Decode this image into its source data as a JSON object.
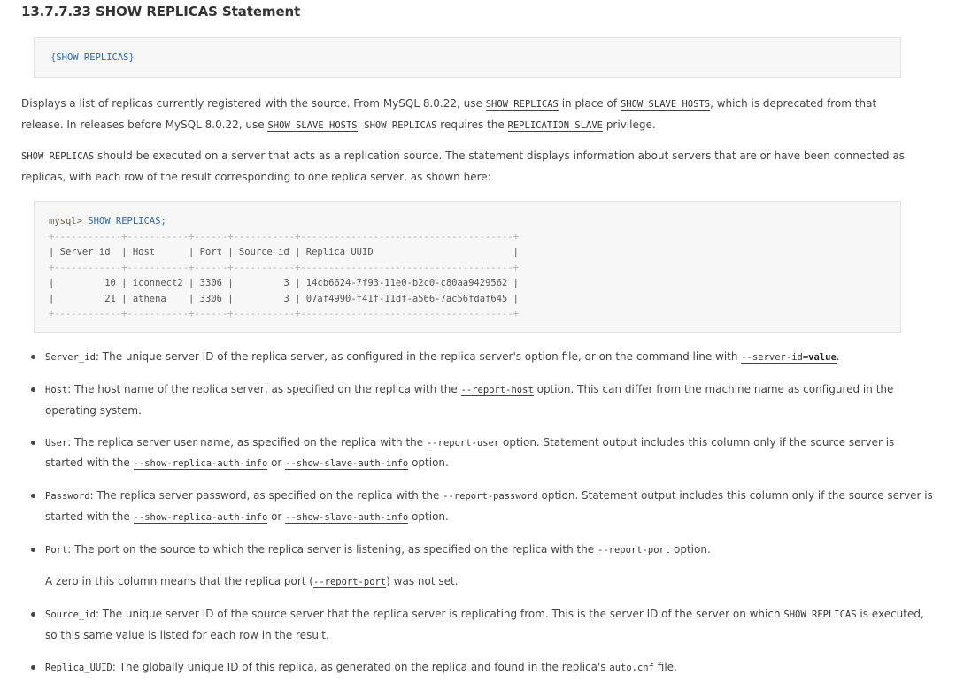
{
  "title": "13.7.7.33 SHOW REPLICAS Statement",
  "syntax": "{SHOW REPLICAS}",
  "para1": {
    "t1": "Displays a list of replicas currently registered with the source. From MySQL 8.0.22, use ",
    "c1": "SHOW REPLICAS",
    "t2": " in place of ",
    "c2": "SHOW SLAVE HOSTS",
    "t3": ", which is deprecated from that release. In releases before MySQL 8.0.22, use ",
    "c3": "SHOW SLAVE HOSTS",
    "t4": ". ",
    "c4": "SHOW REPLICAS",
    "t5": " requires the ",
    "c5": "REPLICATION SLAVE",
    "t6": " privilege."
  },
  "para2": {
    "c1": "SHOW REPLICAS",
    "t1": " should be executed on a server that acts as a replication source. The statement displays information about servers that are or have been connected as replicas, with each row of the result corresponding to one replica server, as shown here:"
  },
  "sample": {
    "prompt": "mysql>",
    "command": " SHOW REPLICAS;",
    "border": "+------------+-----------+------+-----------+--------------------------------------+",
    "header": "| Server_id  | Host      | Port | Source_id | Replica_UUID                         |",
    "row1": "|         10 | iconnect2 | 3306 |         3 | 14cb6624-7f93-11e0-b2c0-c80aa9429562 |",
    "row2": "|         21 | athena    | 3306 |         3 | 07af4990-f41f-11df-a566-7ac56fdaf645 |"
  },
  "items": {
    "server_id": {
      "term": "Server_id",
      "t1": ": The unique server ID of the replica server, as configured in the replica server's option file, or on the command line with ",
      "opt": "--server-id=",
      "val": "value",
      "t2": "."
    },
    "host": {
      "term": "Host",
      "t1": ": The host name of the replica server, as specified on the replica with the ",
      "opt": "--report-host",
      "t2": " option. This can differ from the machine name as configured in the operating system."
    },
    "user": {
      "term": "User",
      "t1": ": The replica server user name, as specified on the replica with the ",
      "opt1": "--report-user",
      "t2": " option. Statement output includes this column only if the source server is started with the ",
      "opt2": "--show-replica-auth-info",
      "t3": " or ",
      "opt3": "--show-slave-auth-info",
      "t4": " option."
    },
    "password": {
      "term": "Password",
      "t1": ": The replica server password, as specified on the replica with the ",
      "opt1": "--report-password",
      "t2": " option. Statement output includes this column only if the source server is started with the ",
      "opt2": "--show-replica-auth-info",
      "t3": " or ",
      "opt3": "--show-slave-auth-info",
      "t4": " option."
    },
    "port": {
      "term": "Port",
      "t1": ": The port on the source to which the replica server is listening, as specified on the replica with the ",
      "opt": "--report-port",
      "t2": " option.",
      "sub_t1": "A zero in this column means that the replica port (",
      "sub_opt": "--report-port",
      "sub_t2": ") was not set."
    },
    "source_id": {
      "term": "Source_id",
      "t1": ": The unique server ID of the source server that the replica server is replicating from. This is the server ID of the server on which ",
      "code": "SHOW REPLICAS",
      "t2": " is executed, so this same value is listed for each row in the result."
    },
    "replica_uuid": {
      "term": "Replica_UUID",
      "t1": ": The globally unique ID of this replica, as generated on the replica and found in the replica's ",
      "code": "auto.cnf",
      "t2": " file."
    }
  }
}
